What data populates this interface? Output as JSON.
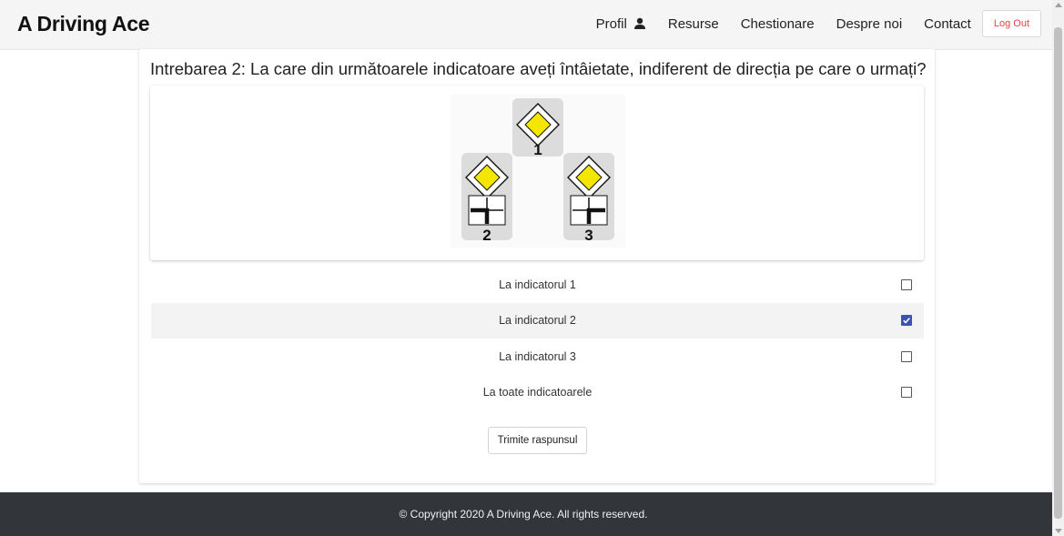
{
  "navbar": {
    "brand": "A Driving Ace",
    "links": {
      "profil": "Profil",
      "resurse": "Resurse",
      "chestionare": "Chestionare",
      "despre": "Despre noi",
      "contact": "Contact"
    },
    "logout": "Log Out"
  },
  "question": {
    "text": "Intrebarea 2: La care din următoarele indicatoare aveți întâietate, indiferent de direcția pe care o urmați?"
  },
  "image": {
    "sign_numbers": [
      "1",
      "2",
      "3"
    ],
    "sign_color": "#f4e600"
  },
  "answers": [
    {
      "label": "La indicatorul 1",
      "checked": false
    },
    {
      "label": "La indicatorul 2",
      "checked": true
    },
    {
      "label": "La indicatorul 3",
      "checked": false
    },
    {
      "label": "La toate indicatoarele",
      "checked": false
    }
  ],
  "submit_label": "Trimite raspunsul",
  "footer": {
    "text": "© Copyright 2020 A Driving Ace. All rights reserved."
  },
  "colors": {
    "accent": "#3f51b5",
    "logout": "#e0434a",
    "footer_bg": "#323539"
  }
}
